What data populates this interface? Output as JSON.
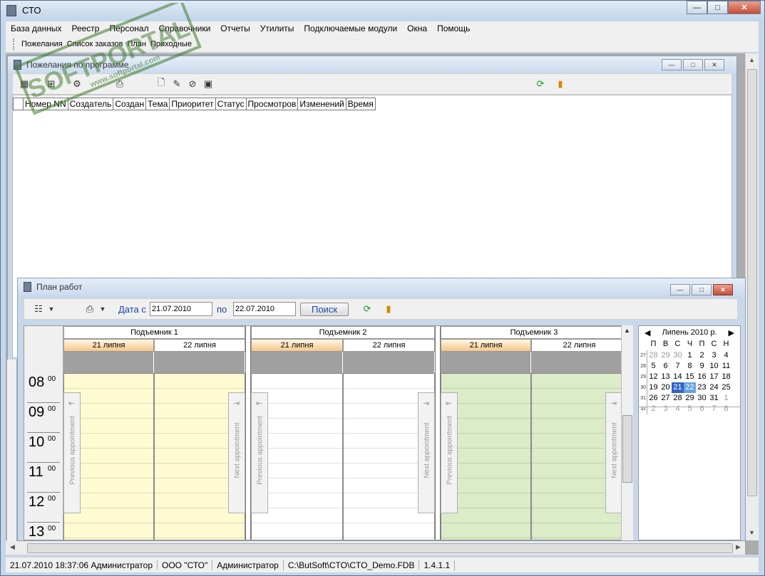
{
  "app": {
    "title": "СТО"
  },
  "window_buttons": {
    "minimize": "—",
    "maximize": "□",
    "close": "✕"
  },
  "menu": [
    "База данных",
    "Реестр",
    "Персонал",
    "Справочники",
    "Отчеты",
    "Утилиты",
    "Подключаемые модули",
    "Окна",
    "Помощь"
  ],
  "window_tabs": [
    "Пожелания",
    "Список заказов",
    "План",
    "Приходные"
  ],
  "wishes_window": {
    "title": "Пожелания по программе",
    "columns": [
      "Номер NN",
      "Создатель",
      "Создан",
      "Тема",
      "Приоритет",
      "Статус",
      "Просмотров",
      "Изменений",
      "Время"
    ]
  },
  "plan_window": {
    "title": "План работ",
    "toolbar": {
      "date_from_label": "Дата с",
      "date_from_value": "21.07.2010",
      "date_to_label": "по",
      "date_to_value": "22.07.2010",
      "search_button": "Поиск"
    },
    "resources": [
      {
        "name": "Подъемник 1",
        "dates": [
          "21 липня",
          "22 липня"
        ],
        "color": "#fefbd2"
      },
      {
        "name": "Подъемник 2",
        "dates": [
          "21 липня",
          "22 липня"
        ],
        "color": "#ffffff"
      },
      {
        "name": "Подъемник 3",
        "dates": [
          "21 липня",
          "22 липня"
        ],
        "color": "#dcecc8"
      }
    ],
    "hours": [
      {
        "h": "08",
        "m": "00"
      },
      {
        "h": "09",
        "m": "00"
      },
      {
        "h": "10",
        "m": "00"
      },
      {
        "h": "11",
        "m": "00"
      },
      {
        "h": "12",
        "m": "00"
      },
      {
        "h": "13",
        "m": "00"
      }
    ],
    "prev_appointment": "Previous appointment",
    "next_appointment": "Next appointment",
    "calendar": {
      "month": "Липень 2010 р.",
      "weekdays": [
        "П",
        "В",
        "С",
        "Ч",
        "П",
        "С",
        "Н"
      ],
      "weeks": [
        {
          "wk": "27",
          "days": [
            "28",
            "29",
            "30",
            "1",
            "2",
            "3",
            "4"
          ]
        },
        {
          "wk": "28",
          "days": [
            "5",
            "6",
            "7",
            "8",
            "9",
            "10",
            "11"
          ]
        },
        {
          "wk": "29",
          "days": [
            "12",
            "13",
            "14",
            "15",
            "16",
            "17",
            "18"
          ]
        },
        {
          "wk": "30",
          "days": [
            "19",
            "20",
            "21",
            "22",
            "23",
            "24",
            "25"
          ]
        },
        {
          "wk": "31",
          "days": [
            "26",
            "27",
            "28",
            "29",
            "30",
            "31",
            "1"
          ]
        },
        {
          "wk": "32",
          "days": [
            "2",
            "3",
            "4",
            "5",
            "6",
            "7",
            "8"
          ]
        }
      ],
      "selected": [
        "21",
        "22"
      ]
    }
  },
  "status": [
    "21.07.2010 18:37:06 Администратор",
    "ООО \"СТО\"",
    "Администратор",
    "C:\\ButSoft\\CTO\\CTO_Demo.FDB",
    "1.4.1.1"
  ],
  "watermark": {
    "brand": "SOFTPORTAL",
    "url": "www.softportal.com"
  },
  "colors": {
    "accent": "#3163c6",
    "today_header": "#f7c68a",
    "close_button": "#c44d33"
  }
}
